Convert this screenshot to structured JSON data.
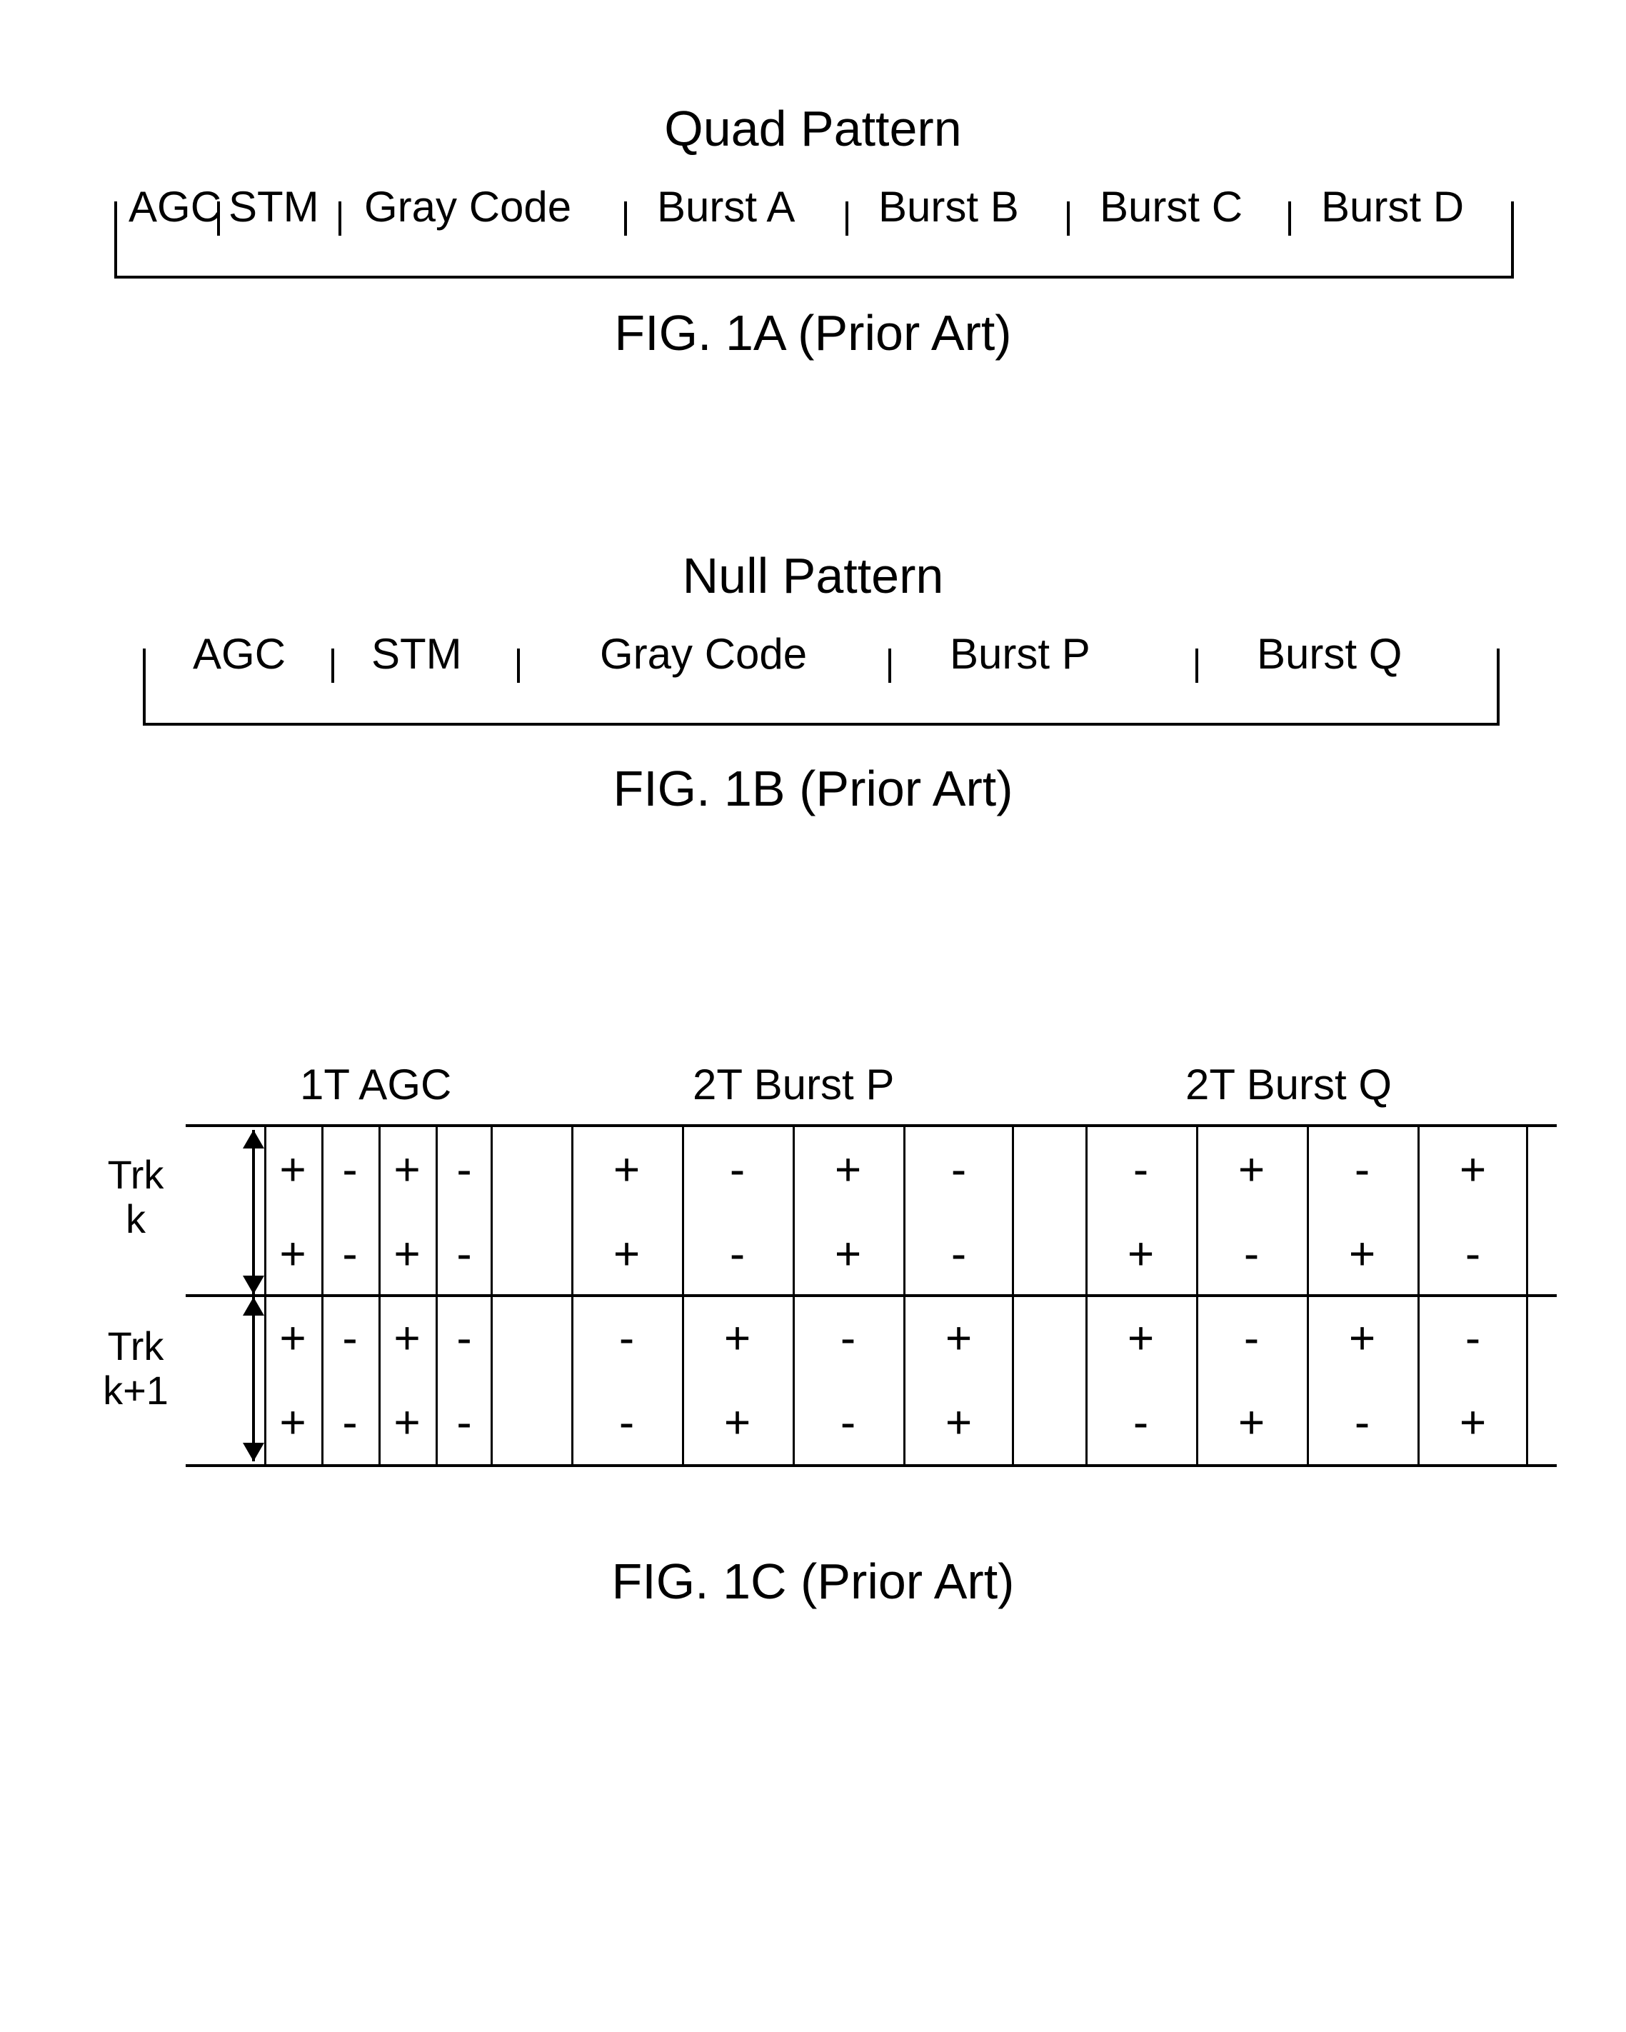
{
  "fig1a": {
    "title": "Quad Pattern",
    "caption": "FIG. 1A (Prior Art)",
    "fields": [
      "AGC",
      "STM",
      "Gray Code",
      "Burst A",
      "Burst B",
      "Burst C",
      "Burst D"
    ]
  },
  "fig1b": {
    "title": "Null Pattern",
    "caption": "FIG. 1B (Prior Art)",
    "fields": [
      "AGC",
      "STM",
      "Gray Code",
      "Burst P",
      "Burst Q"
    ]
  },
  "fig1c": {
    "caption": "FIG. 1C (Prior Art)",
    "headers": [
      "1T AGC",
      "2T Burst P",
      "2T Burst Q"
    ],
    "track_k_label_top": "Trk",
    "track_k_label_bot": "k",
    "track_k1_label_top": "Trk",
    "track_k1_label_bot": "k+1",
    "plus": "+",
    "minus": "-",
    "chart_data": {
      "type": "table",
      "blocks": [
        {
          "name": "1T AGC",
          "cols": 4,
          "col_period": 1,
          "rows": [
            {
              "track": "k",
              "half": "top",
              "cells": [
                "+",
                "-",
                "+",
                "-"
              ]
            },
            {
              "track": "k",
              "half": "bottom",
              "cells": [
                "+",
                "-",
                "+",
                "-"
              ]
            },
            {
              "track": "k+1",
              "half": "top",
              "cells": [
                "+",
                "-",
                "+",
                "-"
              ]
            },
            {
              "track": "k+1",
              "half": "bottom",
              "cells": [
                "+",
                "-",
                "+",
                "-"
              ]
            }
          ]
        },
        {
          "name": "2T Burst P",
          "cols": 4,
          "col_period": 2,
          "rows": [
            {
              "track": "k",
              "half": "top",
              "cells": [
                "+",
                "-",
                "+",
                "-"
              ]
            },
            {
              "track": "k",
              "half": "bottom",
              "cells": [
                "+",
                "-",
                "+",
                "-"
              ]
            },
            {
              "track": "k+1",
              "half": "top",
              "cells": [
                "-",
                "+",
                "-",
                "+"
              ]
            },
            {
              "track": "k+1",
              "half": "bottom",
              "cells": [
                "-",
                "+",
                "-",
                "+"
              ]
            }
          ]
        },
        {
          "name": "2T Burst Q",
          "cols": 4,
          "col_period": 2,
          "rows": [
            {
              "track": "k",
              "half": "top",
              "cells": [
                "-",
                "+",
                "-",
                "+"
              ]
            },
            {
              "track": "k",
              "half": "bottom",
              "cells": [
                "+",
                "-",
                "+",
                "-"
              ]
            },
            {
              "track": "k+1",
              "half": "top",
              "cells": [
                "+",
                "-",
                "+",
                "-"
              ]
            },
            {
              "track": "k+1",
              "half": "bottom",
              "cells": [
                "-",
                "+",
                "-",
                "+"
              ]
            }
          ]
        }
      ]
    }
  }
}
